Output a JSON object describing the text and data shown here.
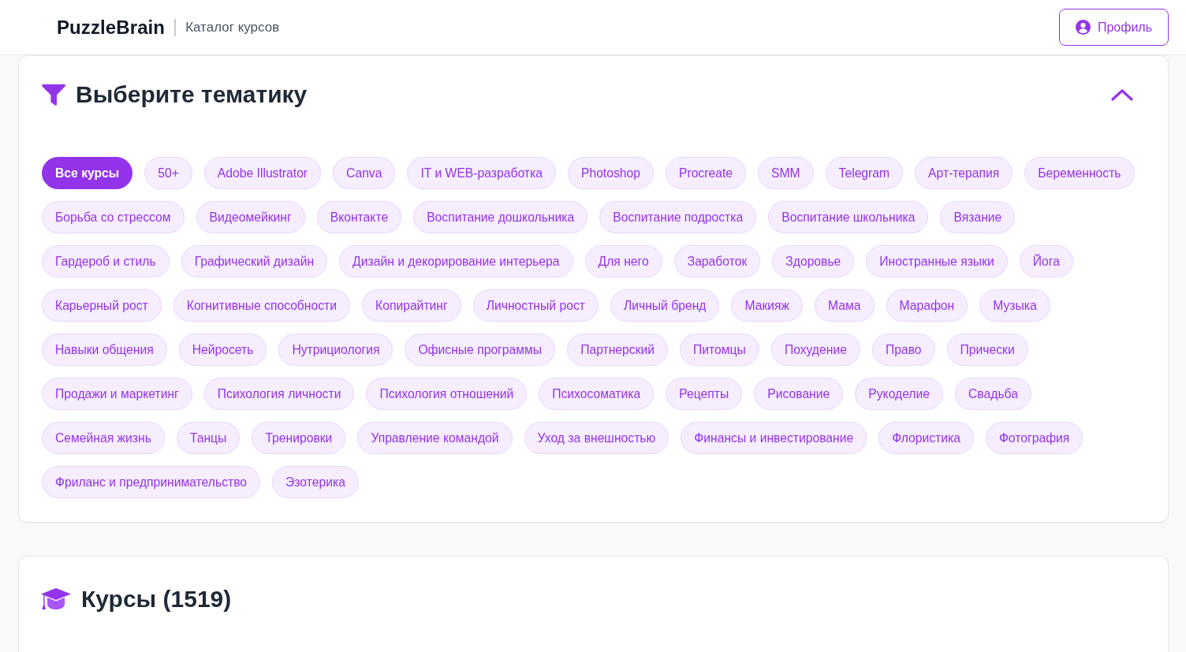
{
  "header": {
    "logo": "PuzzleBrain",
    "subtitle": "Каталог курсов",
    "profile_button": "Профиль"
  },
  "topics_panel": {
    "title": "Выберите тематику",
    "expanded": true,
    "topics": [
      {
        "label": "Все курсы",
        "selected": true
      },
      {
        "label": "50+",
        "selected": false
      },
      {
        "label": "Adobe Illustrator",
        "selected": false
      },
      {
        "label": "Canva",
        "selected": false
      },
      {
        "label": "IT и WEB-разработка",
        "selected": false
      },
      {
        "label": "Photoshop",
        "selected": false
      },
      {
        "label": "Procreate",
        "selected": false
      },
      {
        "label": "SMM",
        "selected": false
      },
      {
        "label": "Telegram",
        "selected": false
      },
      {
        "label": "Арт-терапия",
        "selected": false
      },
      {
        "label": "Беременность",
        "selected": false
      },
      {
        "label": "Борьба со стрессом",
        "selected": false
      },
      {
        "label": "Видеомейкинг",
        "selected": false
      },
      {
        "label": "Вконтакте",
        "selected": false
      },
      {
        "label": "Воспитание дошкольника",
        "selected": false
      },
      {
        "label": "Воспитание подростка",
        "selected": false
      },
      {
        "label": "Воспитание школьника",
        "selected": false
      },
      {
        "label": "Вязание",
        "selected": false
      },
      {
        "label": "Гардероб и стиль",
        "selected": false
      },
      {
        "label": "Графический дизайн",
        "selected": false
      },
      {
        "label": "Дизайн и декорирование интерьера",
        "selected": false
      },
      {
        "label": "Для него",
        "selected": false
      },
      {
        "label": "Заработок",
        "selected": false
      },
      {
        "label": "Здоровье",
        "selected": false
      },
      {
        "label": "Иностранные языки",
        "selected": false
      },
      {
        "label": "Йога",
        "selected": false
      },
      {
        "label": "Карьерный рост",
        "selected": false
      },
      {
        "label": "Когнитивные способности",
        "selected": false
      },
      {
        "label": "Копирайтинг",
        "selected": false
      },
      {
        "label": "Личностный рост",
        "selected": false
      },
      {
        "label": "Личный бренд",
        "selected": false
      },
      {
        "label": "Макияж",
        "selected": false
      },
      {
        "label": "Мама",
        "selected": false
      },
      {
        "label": "Марафон",
        "selected": false
      },
      {
        "label": "Музыка",
        "selected": false
      },
      {
        "label": "Навыки общения",
        "selected": false
      },
      {
        "label": "Нейросеть",
        "selected": false
      },
      {
        "label": "Нутрициология",
        "selected": false
      },
      {
        "label": "Офисные программы",
        "selected": false
      },
      {
        "label": "Партнерский",
        "selected": false
      },
      {
        "label": "Питомцы",
        "selected": false
      },
      {
        "label": "Похудение",
        "selected": false
      },
      {
        "label": "Право",
        "selected": false
      },
      {
        "label": "Прически",
        "selected": false
      },
      {
        "label": "Продажи и маркетинг",
        "selected": false
      },
      {
        "label": "Психология личности",
        "selected": false
      },
      {
        "label": "Психология отношений",
        "selected": false
      },
      {
        "label": "Психосоматика",
        "selected": false
      },
      {
        "label": "Рецепты",
        "selected": false
      },
      {
        "label": "Рисование",
        "selected": false
      },
      {
        "label": "Рукоделие",
        "selected": false
      },
      {
        "label": "Свадьба",
        "selected": false
      },
      {
        "label": "Семейная жизнь",
        "selected": false
      },
      {
        "label": "Танцы",
        "selected": false
      },
      {
        "label": "Тренировки",
        "selected": false
      },
      {
        "label": "Управление командой",
        "selected": false
      },
      {
        "label": "Уход за внешностью",
        "selected": false
      },
      {
        "label": "Финансы и инвестирование",
        "selected": false
      },
      {
        "label": "Флористика",
        "selected": false
      },
      {
        "label": "Фотография",
        "selected": false
      },
      {
        "label": "Фриланс и предпринимательство",
        "selected": false
      },
      {
        "label": "Эзотерика",
        "selected": false
      }
    ]
  },
  "courses_panel": {
    "title": "Курсы (1519)"
  }
}
